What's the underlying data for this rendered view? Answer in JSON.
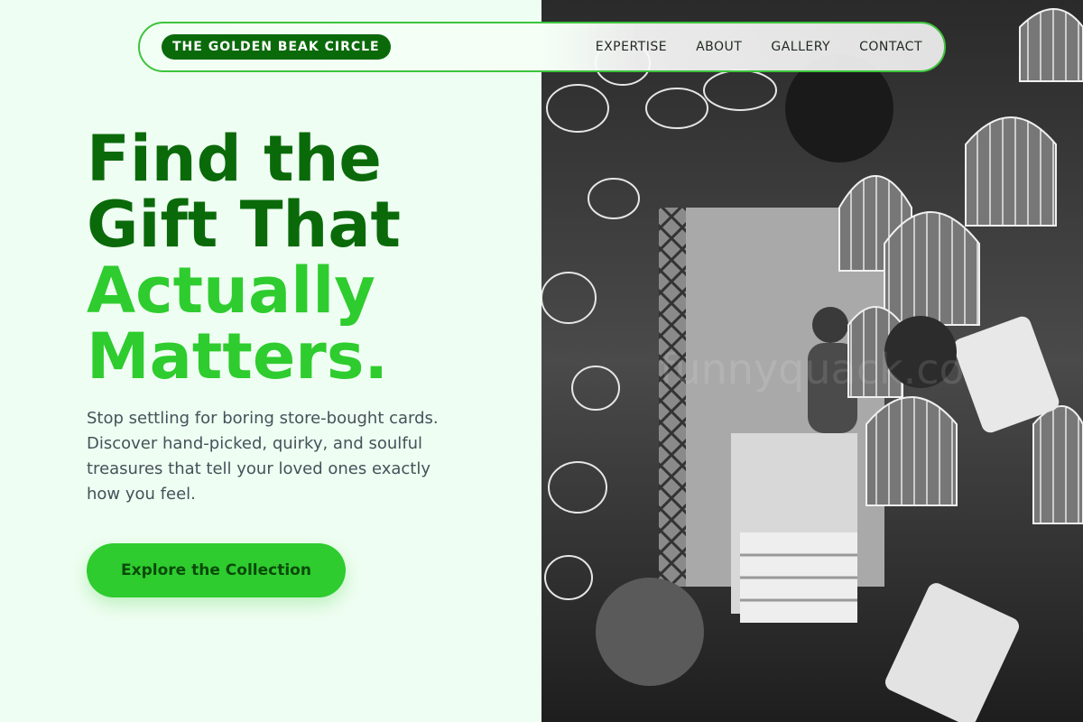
{
  "nav": {
    "brand": "THE GOLDEN BEAK CIRCLE",
    "links": [
      "EXPERTISE",
      "ABOUT",
      "GALLERY",
      "CONTACT"
    ]
  },
  "hero": {
    "title_line1": "Find the",
    "title_line2": "Gift That",
    "title_line3": "Actually",
    "title_line4": "Matters.",
    "description": "Stop settling for boring store-bought cards. Discover hand-picked, quirky, and soulful treasures that tell your loved ones exactly how you feel.",
    "cta_label": "Explore the Collection"
  },
  "image": {
    "watermark": "funnyquack.co"
  },
  "colors": {
    "background": "#effef2",
    "brand_dark_green": "#0a6a0a",
    "accent_green": "#2ecc2e",
    "text_gray": "#44525a"
  }
}
